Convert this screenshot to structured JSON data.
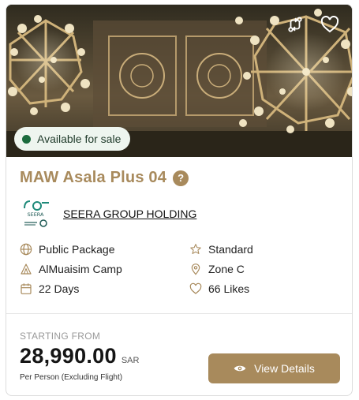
{
  "hero": {
    "badge_label": "Available for sale",
    "actions": [
      {
        "icon": "compare-icon"
      },
      {
        "icon": "heart-outline-icon"
      }
    ]
  },
  "package": {
    "title": "MAW Asala Plus 04",
    "help_icon": "?",
    "agency_name": "SEERA GROUP HOLDING",
    "agency_logo_text": "SEERA"
  },
  "features": [
    {
      "icon": "globe-icon",
      "label": "Public Package"
    },
    {
      "icon": "star-outline-icon",
      "label": "Standard"
    },
    {
      "icon": "tent-icon",
      "label": "AlMuaisim Camp"
    },
    {
      "icon": "location-pin-icon",
      "label": "Zone C"
    },
    {
      "icon": "calendar-icon",
      "label": "22 Days"
    },
    {
      "icon": "heart-outline-icon",
      "label": "66 Likes"
    }
  ],
  "pricing": {
    "starting_label": "STARTING FROM",
    "price": "28,990.00",
    "currency": "SAR",
    "note": "Per Person (Excluding Flight)"
  },
  "cta": {
    "label": "View Details",
    "icon": "eye-icon"
  },
  "colors": {
    "accent": "#a88a5c",
    "badge_dot": "#1b6b3d",
    "badge_bg": "#eef5ef"
  }
}
